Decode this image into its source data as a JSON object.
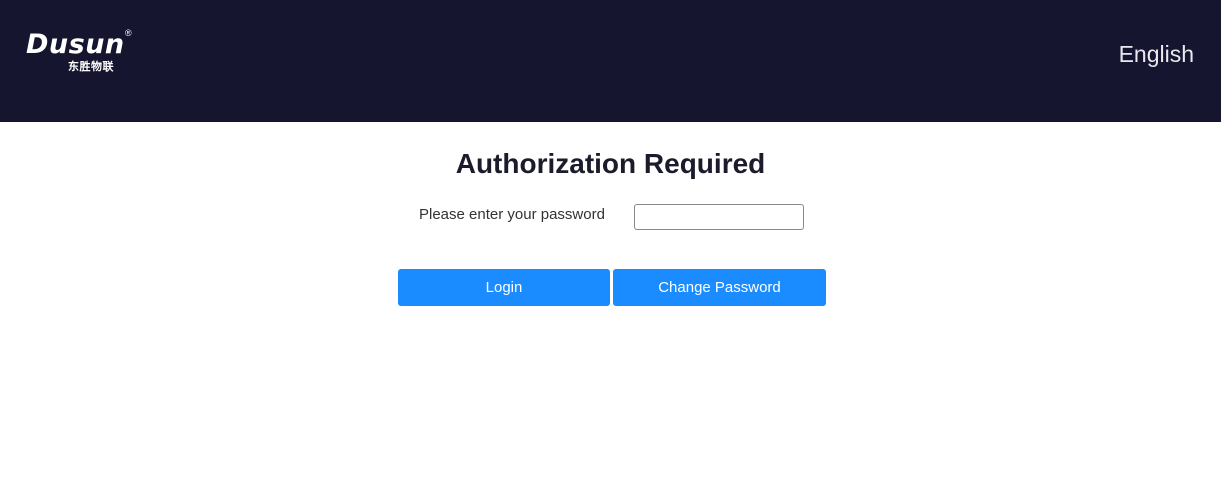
{
  "header": {
    "logo": {
      "main": "Dusun",
      "registered": "®",
      "sub": "东胜物联"
    },
    "language": "English"
  },
  "main": {
    "title": "Authorization Required",
    "password_label": "Please enter your password",
    "password_value": "",
    "login_label": "Login",
    "change_password_label": "Change Password"
  },
  "colors": {
    "header_bg": "#15152f",
    "button_bg": "#1a8cff"
  }
}
